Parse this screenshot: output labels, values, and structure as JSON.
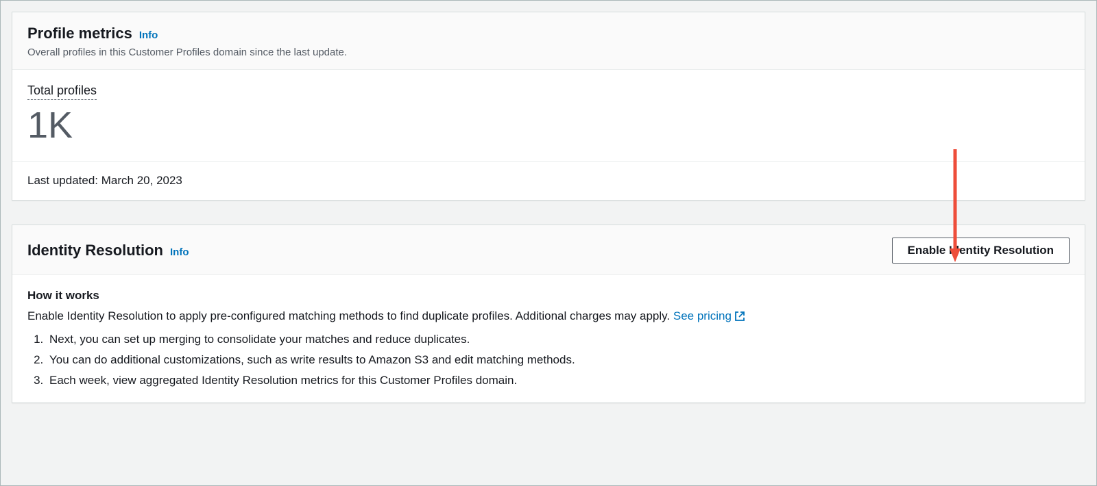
{
  "profileMetrics": {
    "title": "Profile metrics",
    "infoLabel": "Info",
    "subtitle": "Overall profiles in this Customer Profiles domain since the last update.",
    "totalProfilesLabel": "Total profiles",
    "totalProfilesValue": "1K",
    "lastUpdated": "Last updated: March 20, 2023"
  },
  "identityResolution": {
    "title": "Identity Resolution",
    "infoLabel": "Info",
    "enableButtonLabel": "Enable Identity Resolution",
    "howItWorksTitle": "How it works",
    "description": "Enable Identity Resolution to apply pre-configured matching methods to find duplicate profiles. Additional charges may apply. ",
    "seePricingLabel": "See pricing",
    "steps": [
      "Next, you can set up merging to consolidate your matches and reduce duplicates.",
      "You can do additional customizations, such as write results to Amazon S3 and edit matching methods.",
      "Each week, view aggregated Identity Resolution metrics for this Customer Profiles domain."
    ]
  }
}
